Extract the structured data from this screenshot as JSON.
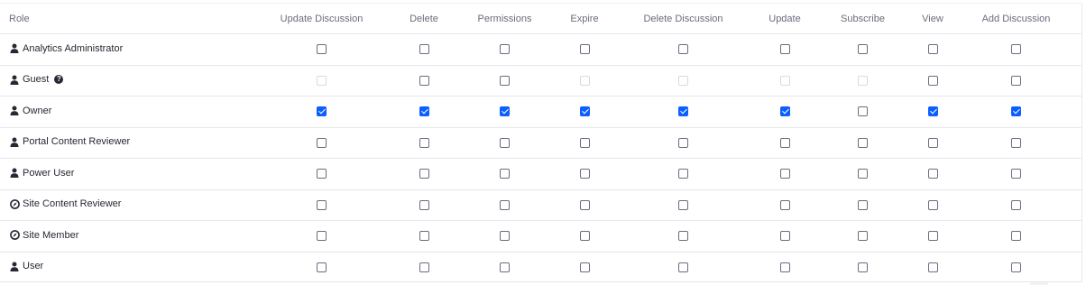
{
  "columns": [
    "Role",
    "Update Discussion",
    "Delete",
    "Permissions",
    "Expire",
    "Delete Discussion",
    "Update",
    "Subscribe",
    "View",
    "Add Discussion"
  ],
  "rows": [
    {
      "role": "Analytics Administrator",
      "icon": "user-icon",
      "help": false,
      "checked": [
        false,
        false,
        false,
        false,
        false,
        false,
        false,
        false,
        false
      ],
      "disabled": [
        false,
        false,
        false,
        false,
        false,
        false,
        false,
        false,
        false
      ]
    },
    {
      "role": "Guest",
      "icon": "user-icon",
      "help": true,
      "checked": [
        false,
        false,
        false,
        false,
        false,
        false,
        false,
        false,
        false
      ],
      "disabled": [
        true,
        false,
        false,
        true,
        true,
        true,
        true,
        false,
        false
      ]
    },
    {
      "role": "Owner",
      "icon": "user-icon",
      "help": false,
      "checked": [
        true,
        true,
        true,
        true,
        true,
        true,
        false,
        true,
        true
      ],
      "disabled": [
        false,
        false,
        false,
        false,
        false,
        false,
        false,
        false,
        false
      ]
    },
    {
      "role": "Portal Content Reviewer",
      "icon": "user-icon",
      "help": false,
      "checked": [
        false,
        false,
        false,
        false,
        false,
        false,
        false,
        false,
        false
      ],
      "disabled": [
        false,
        false,
        false,
        false,
        false,
        false,
        false,
        false,
        false
      ]
    },
    {
      "role": "Power User",
      "icon": "user-icon",
      "help": false,
      "checked": [
        false,
        false,
        false,
        false,
        false,
        false,
        false,
        false,
        false
      ],
      "disabled": [
        false,
        false,
        false,
        false,
        false,
        false,
        false,
        false,
        false
      ]
    },
    {
      "role": "Site Content Reviewer",
      "icon": "compass-icon",
      "help": false,
      "checked": [
        false,
        false,
        false,
        false,
        false,
        false,
        false,
        false,
        false
      ],
      "disabled": [
        false,
        false,
        false,
        false,
        false,
        false,
        false,
        false,
        false
      ]
    },
    {
      "role": "Site Member",
      "icon": "compass-icon",
      "help": false,
      "checked": [
        false,
        false,
        false,
        false,
        false,
        false,
        false,
        false,
        false
      ],
      "disabled": [
        false,
        false,
        false,
        false,
        false,
        false,
        false,
        false,
        false
      ]
    },
    {
      "role": "User",
      "icon": "user-icon",
      "help": false,
      "checked": [
        false,
        false,
        false,
        false,
        false,
        false,
        false,
        false,
        false
      ],
      "disabled": [
        false,
        false,
        false,
        false,
        false,
        false,
        false,
        false,
        false
      ]
    }
  ],
  "colors": {
    "accent": "#0b5fff",
    "text": "#272833",
    "muted": "#6b6c7e",
    "border": "#e7e7ed"
  }
}
